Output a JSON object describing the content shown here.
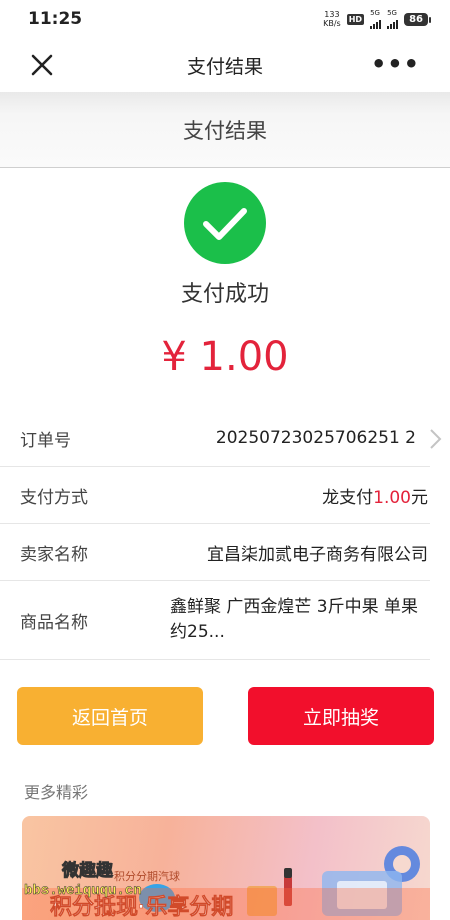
{
  "status_bar": {
    "time": "11:25",
    "net_speed_value": "133",
    "net_speed_unit": "KB/s",
    "hd_label": "HD",
    "sim1_label": "5G",
    "sim2_label": "5G",
    "battery": "86"
  },
  "nav": {
    "title": "支付结果",
    "more_label": "•••"
  },
  "subheader": {
    "title": "支付结果"
  },
  "result": {
    "status_text": "支付成功",
    "amount": "¥ 1.00",
    "success_color": "#1bbf4a",
    "amount_color": "#e3233b"
  },
  "details": {
    "order_no_label": "订单号",
    "order_no": "20250723025706251 2",
    "payment_label": "支付方式",
    "payment_method": "龙支付",
    "payment_amount": "1.00",
    "payment_unit": "元",
    "seller_label": "卖家名称",
    "seller": "宜昌柒加贰电子商务有限公司",
    "goods_label": "商品名称",
    "goods": "鑫鲜聚 广西金煌芒 3斤中果 单果约25..."
  },
  "buttons": {
    "home": "返回首页",
    "lottery": "立即抽奖",
    "home_color": "#f8b032",
    "lottery_color": "#f20f2c"
  },
  "more": {
    "label": "更多精彩",
    "banner_text_top": "积分分期汽球",
    "banner_text_main": "积分抵现·乐享分期",
    "watermark_title": "微趣趣",
    "watermark_url": "bbs.weiququ.cn"
  }
}
